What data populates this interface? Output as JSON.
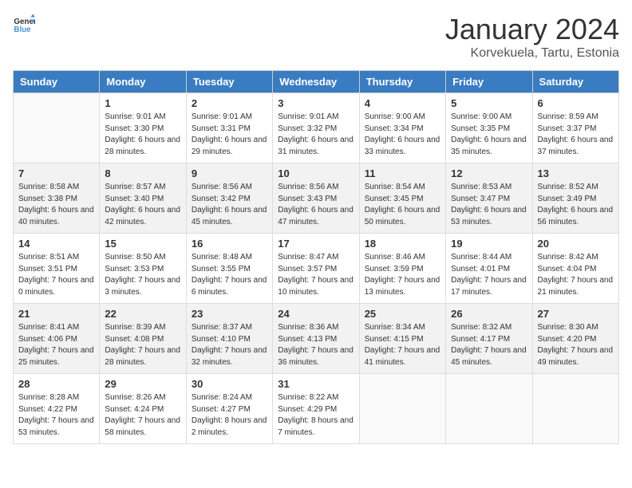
{
  "header": {
    "logo_general": "General",
    "logo_blue": "Blue",
    "month_title": "January 2024",
    "location": "Korvekuela, Tartu, Estonia"
  },
  "days_of_week": [
    "Sunday",
    "Monday",
    "Tuesday",
    "Wednesday",
    "Thursday",
    "Friday",
    "Saturday"
  ],
  "weeks": [
    [
      {
        "day": "",
        "sunrise": "",
        "sunset": "",
        "daylight": ""
      },
      {
        "day": "1",
        "sunrise": "Sunrise: 9:01 AM",
        "sunset": "Sunset: 3:30 PM",
        "daylight": "Daylight: 6 hours and 28 minutes."
      },
      {
        "day": "2",
        "sunrise": "Sunrise: 9:01 AM",
        "sunset": "Sunset: 3:31 PM",
        "daylight": "Daylight: 6 hours and 29 minutes."
      },
      {
        "day": "3",
        "sunrise": "Sunrise: 9:01 AM",
        "sunset": "Sunset: 3:32 PM",
        "daylight": "Daylight: 6 hours and 31 minutes."
      },
      {
        "day": "4",
        "sunrise": "Sunrise: 9:00 AM",
        "sunset": "Sunset: 3:34 PM",
        "daylight": "Daylight: 6 hours and 33 minutes."
      },
      {
        "day": "5",
        "sunrise": "Sunrise: 9:00 AM",
        "sunset": "Sunset: 3:35 PM",
        "daylight": "Daylight: 6 hours and 35 minutes."
      },
      {
        "day": "6",
        "sunrise": "Sunrise: 8:59 AM",
        "sunset": "Sunset: 3:37 PM",
        "daylight": "Daylight: 6 hours and 37 minutes."
      }
    ],
    [
      {
        "day": "7",
        "sunrise": "Sunrise: 8:58 AM",
        "sunset": "Sunset: 3:38 PM",
        "daylight": "Daylight: 6 hours and 40 minutes."
      },
      {
        "day": "8",
        "sunrise": "Sunrise: 8:57 AM",
        "sunset": "Sunset: 3:40 PM",
        "daylight": "Daylight: 6 hours and 42 minutes."
      },
      {
        "day": "9",
        "sunrise": "Sunrise: 8:56 AM",
        "sunset": "Sunset: 3:42 PM",
        "daylight": "Daylight: 6 hours and 45 minutes."
      },
      {
        "day": "10",
        "sunrise": "Sunrise: 8:56 AM",
        "sunset": "Sunset: 3:43 PM",
        "daylight": "Daylight: 6 hours and 47 minutes."
      },
      {
        "day": "11",
        "sunrise": "Sunrise: 8:54 AM",
        "sunset": "Sunset: 3:45 PM",
        "daylight": "Daylight: 6 hours and 50 minutes."
      },
      {
        "day": "12",
        "sunrise": "Sunrise: 8:53 AM",
        "sunset": "Sunset: 3:47 PM",
        "daylight": "Daylight: 6 hours and 53 minutes."
      },
      {
        "day": "13",
        "sunrise": "Sunrise: 8:52 AM",
        "sunset": "Sunset: 3:49 PM",
        "daylight": "Daylight: 6 hours and 56 minutes."
      }
    ],
    [
      {
        "day": "14",
        "sunrise": "Sunrise: 8:51 AM",
        "sunset": "Sunset: 3:51 PM",
        "daylight": "Daylight: 7 hours and 0 minutes."
      },
      {
        "day": "15",
        "sunrise": "Sunrise: 8:50 AM",
        "sunset": "Sunset: 3:53 PM",
        "daylight": "Daylight: 7 hours and 3 minutes."
      },
      {
        "day": "16",
        "sunrise": "Sunrise: 8:48 AM",
        "sunset": "Sunset: 3:55 PM",
        "daylight": "Daylight: 7 hours and 6 minutes."
      },
      {
        "day": "17",
        "sunrise": "Sunrise: 8:47 AM",
        "sunset": "Sunset: 3:57 PM",
        "daylight": "Daylight: 7 hours and 10 minutes."
      },
      {
        "day": "18",
        "sunrise": "Sunrise: 8:46 AM",
        "sunset": "Sunset: 3:59 PM",
        "daylight": "Daylight: 7 hours and 13 minutes."
      },
      {
        "day": "19",
        "sunrise": "Sunrise: 8:44 AM",
        "sunset": "Sunset: 4:01 PM",
        "daylight": "Daylight: 7 hours and 17 minutes."
      },
      {
        "day": "20",
        "sunrise": "Sunrise: 8:42 AM",
        "sunset": "Sunset: 4:04 PM",
        "daylight": "Daylight: 7 hours and 21 minutes."
      }
    ],
    [
      {
        "day": "21",
        "sunrise": "Sunrise: 8:41 AM",
        "sunset": "Sunset: 4:06 PM",
        "daylight": "Daylight: 7 hours and 25 minutes."
      },
      {
        "day": "22",
        "sunrise": "Sunrise: 8:39 AM",
        "sunset": "Sunset: 4:08 PM",
        "daylight": "Daylight: 7 hours and 28 minutes."
      },
      {
        "day": "23",
        "sunrise": "Sunrise: 8:37 AM",
        "sunset": "Sunset: 4:10 PM",
        "daylight": "Daylight: 7 hours and 32 minutes."
      },
      {
        "day": "24",
        "sunrise": "Sunrise: 8:36 AM",
        "sunset": "Sunset: 4:13 PM",
        "daylight": "Daylight: 7 hours and 36 minutes."
      },
      {
        "day": "25",
        "sunrise": "Sunrise: 8:34 AM",
        "sunset": "Sunset: 4:15 PM",
        "daylight": "Daylight: 7 hours and 41 minutes."
      },
      {
        "day": "26",
        "sunrise": "Sunrise: 8:32 AM",
        "sunset": "Sunset: 4:17 PM",
        "daylight": "Daylight: 7 hours and 45 minutes."
      },
      {
        "day": "27",
        "sunrise": "Sunrise: 8:30 AM",
        "sunset": "Sunset: 4:20 PM",
        "daylight": "Daylight: 7 hours and 49 minutes."
      }
    ],
    [
      {
        "day": "28",
        "sunrise": "Sunrise: 8:28 AM",
        "sunset": "Sunset: 4:22 PM",
        "daylight": "Daylight: 7 hours and 53 minutes."
      },
      {
        "day": "29",
        "sunrise": "Sunrise: 8:26 AM",
        "sunset": "Sunset: 4:24 PM",
        "daylight": "Daylight: 7 hours and 58 minutes."
      },
      {
        "day": "30",
        "sunrise": "Sunrise: 8:24 AM",
        "sunset": "Sunset: 4:27 PM",
        "daylight": "Daylight: 8 hours and 2 minutes."
      },
      {
        "day": "31",
        "sunrise": "Sunrise: 8:22 AM",
        "sunset": "Sunset: 4:29 PM",
        "daylight": "Daylight: 8 hours and 7 minutes."
      },
      {
        "day": "",
        "sunrise": "",
        "sunset": "",
        "daylight": ""
      },
      {
        "day": "",
        "sunrise": "",
        "sunset": "",
        "daylight": ""
      },
      {
        "day": "",
        "sunrise": "",
        "sunset": "",
        "daylight": ""
      }
    ]
  ]
}
